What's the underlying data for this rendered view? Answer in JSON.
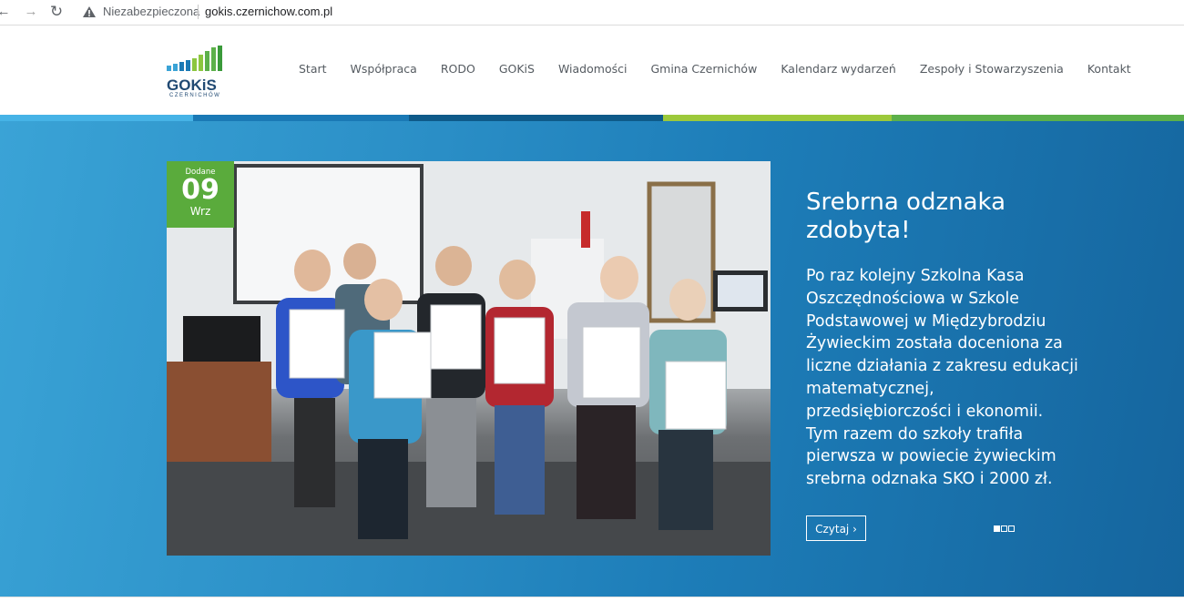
{
  "browser": {
    "security_label": "Niezabezpieczona",
    "url": "gokis.czernichow.com.pl"
  },
  "site": {
    "logo_text": "GOKiS",
    "logo_subtext": "CZERNICHÓW",
    "menu": [
      {
        "label": "Start"
      },
      {
        "label": "Współpraca"
      },
      {
        "label": "RODO"
      },
      {
        "label": "GOKiS"
      },
      {
        "label": "Wiadomości"
      },
      {
        "label": "Gmina Czernichów"
      },
      {
        "label": "Kalendarz wydarzeń"
      },
      {
        "label": "Zespoły i Stowarzyszenia"
      },
      {
        "label": "Kontakt"
      }
    ],
    "stripe_colors": [
      "#46b3e6",
      "#1a79b5",
      "#0e5a89",
      "#9cc93b",
      "#5cb04a"
    ]
  },
  "slide": {
    "date_label": "Dodane",
    "date_day": "09",
    "date_month": "Wrz",
    "title": "Srebrna odznaka zdobyta!",
    "text": "Po raz kolejny Szkolna Kasa Oszczędnościowa w Szkole Podstawowej w Międzybrodziu Żywieckim została doceniona za liczne działania z zakresu edukacji matematycznej, przedsiębiorczości i ekonomii. Tym razem do szkoły trafiła pierwsza w powiecie żywieckim srebrna odznaka SKO i 2000 zł.",
    "read_more": "Czytaj ›",
    "slides_total": 3,
    "slides_active": 1
  },
  "colors": {
    "badge_green": "#5aab3c",
    "hero_blue": "#2a8ec6"
  }
}
